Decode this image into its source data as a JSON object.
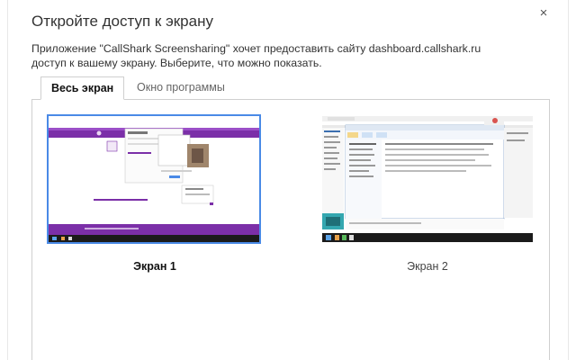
{
  "dialog": {
    "title": "Откройте доступ к экрану",
    "close_glyph": "×",
    "description": "Приложение \"CallShark Screensharing\" хочет предоставить сайту dashboard.callshark.ru доступ к вашему экрану. Выберите, что можно показать."
  },
  "tabs": [
    {
      "label": "Весь экран",
      "active": true
    },
    {
      "label": "Окно программы",
      "active": false
    }
  ],
  "screens": [
    {
      "label": "Экран 1",
      "selected": true
    },
    {
      "label": "Экран 2",
      "selected": false
    }
  ],
  "colors": {
    "accent": "#4a8ae6",
    "thumb1_brand": "#7b2fa8",
    "taskbar": "#1b1b1b"
  }
}
